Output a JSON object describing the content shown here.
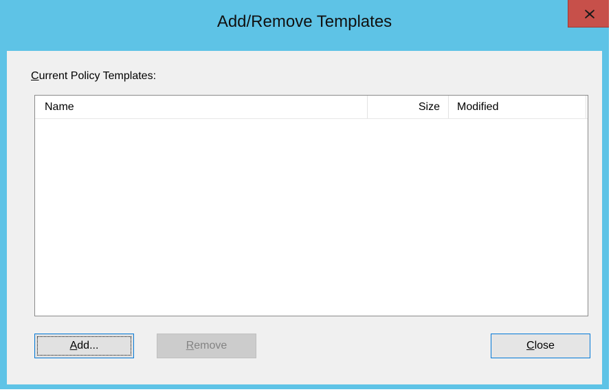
{
  "window": {
    "title": "Add/Remove Templates",
    "close_glyph": "x-icon"
  },
  "section": {
    "label_first": "C",
    "label_rest": "urrent Policy Templates:"
  },
  "table": {
    "columns": [
      "Name",
      "Size",
      "Modified"
    ],
    "rows": []
  },
  "buttons": {
    "add_first": "A",
    "add_rest": "dd...",
    "remove_first": "R",
    "remove_rest": "emove",
    "close_first": "C",
    "close_rest": "lose"
  },
  "colors": {
    "titlebar": "#5ec3e6",
    "close_button": "#c7504a",
    "dialog_body": "#f0f0f0"
  }
}
